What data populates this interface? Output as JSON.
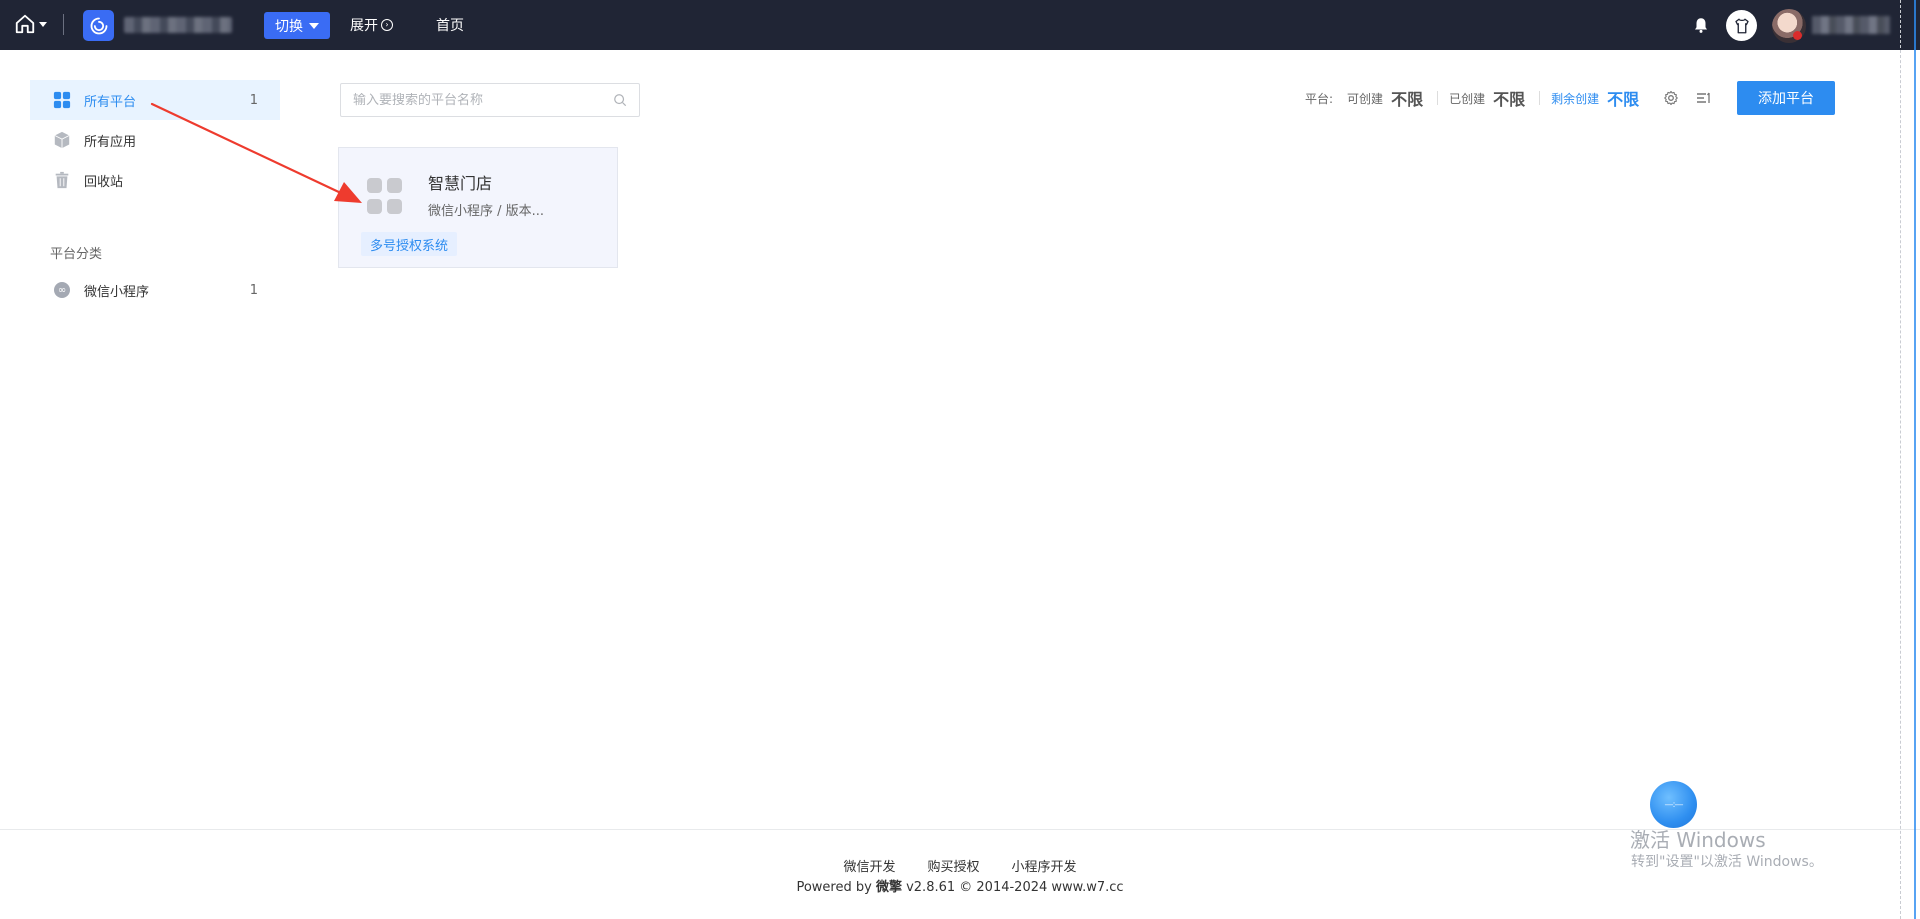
{
  "topbar": {
    "switch_label": "切换",
    "expand_label": "展开",
    "home_label": "首页"
  },
  "sidebar": {
    "items": [
      {
        "label": "所有平台",
        "count": "1",
        "icon": "grid-icon",
        "active": true
      },
      {
        "label": "所有应用",
        "count": "",
        "icon": "cube-icon",
        "active": false
      },
      {
        "label": "回收站",
        "count": "",
        "icon": "trash-icon",
        "active": false
      }
    ],
    "section_title": "平台分类",
    "categories": [
      {
        "label": "微信小程序",
        "count": "1",
        "icon": "mini-program-icon"
      }
    ]
  },
  "search": {
    "placeholder": "输入要搜索的平台名称",
    "value": ""
  },
  "stats": {
    "prefix": "平台:",
    "creatable_label": "可创建",
    "creatable_value": "不限",
    "created_label": "已创建",
    "created_value": "不限",
    "remaining_label": "剩余创建",
    "remaining_value": "不限"
  },
  "toolbar": {
    "add_label": "添加平台"
  },
  "card": {
    "title": "智慧门店",
    "subtitle": "微信小程序 / 版本...",
    "tag": "多号授权系统"
  },
  "footer": {
    "links": [
      "微信开发",
      "购买授权",
      "小程序开发"
    ],
    "copy_prefix": "Powered by",
    "brand": "微擎",
    "copy_suffix": "v2.8.61 © 2014-2024 www.w7.cc"
  },
  "watermark": {
    "ball_text": "—:—",
    "title": "激活 Windows",
    "subtitle": "转到\"设置\"以激活 Windows。"
  },
  "colors": {
    "topbar_bg": "#202535",
    "accent": "#2d8cf0",
    "switch_bg": "#3a6cf4",
    "active_item_bg": "#e8f3ff",
    "card_bg": "#f3f5fd",
    "annotation_arrow": "#ee3b2e"
  }
}
